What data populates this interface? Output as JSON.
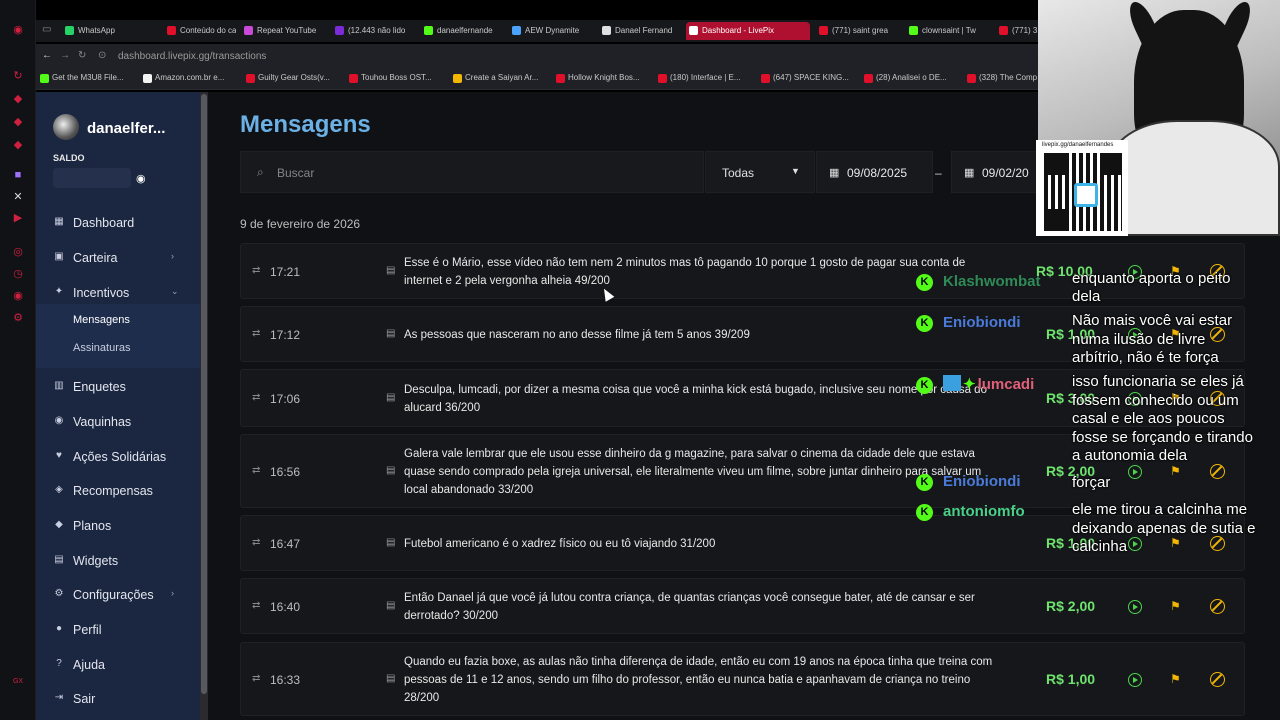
{
  "browser": {
    "tabs": [
      {
        "label": "WhatsApp",
        "color": "#25d366"
      },
      {
        "label": "Conteúdo do ca",
        "color": "#e0102b"
      },
      {
        "label": "Repeat YouTube",
        "color": "#c94ad8"
      },
      {
        "label": "(12.443 não lido",
        "color": "#7b2cd6"
      },
      {
        "label": "danaelfernande",
        "color": "#53fc18"
      },
      {
        "label": "AEW Dynamite",
        "color": "#4aa3ff"
      },
      {
        "label": "Danael Fernand",
        "color": "#e0e0e0"
      },
      {
        "label": "Dashboard - LivePix",
        "color": "#ffffff"
      },
      {
        "label": "(771) saint grea",
        "color": "#e0102b"
      },
      {
        "label": "clownsaint | Tw",
        "color": "#53fc18"
      },
      {
        "label": "(771) 3",
        "color": "#e0102b"
      }
    ],
    "url": "dashboard.livepix.gg/transactions",
    "bookmarks": [
      {
        "label": "Get the M3U8 File...",
        "color": "#53fc18"
      },
      {
        "label": "Amazon.com.br e...",
        "color": "#f3f3f3"
      },
      {
        "label": "Guilty Gear Osts(v...",
        "color": "#e0102b"
      },
      {
        "label": "Touhou Boss OST...",
        "color": "#e0102b"
      },
      {
        "label": "Create a Saiyan Ar...",
        "color": "#f2b705"
      },
      {
        "label": "Hollow Knight Bos...",
        "color": "#e0102b"
      },
      {
        "label": "(180) Interface | E...",
        "color": "#e0102b"
      },
      {
        "label": "(647) SPACE KING...",
        "color": "#e0102b"
      },
      {
        "label": "(28) Analisei o DE...",
        "color": "#e0102b"
      },
      {
        "label": "(328) The Comp",
        "color": "#e0102b"
      }
    ]
  },
  "sidebar": {
    "username": "danaelfer...",
    "saldo_label": "SALDO",
    "items": [
      {
        "label": "Dashboard",
        "icon": "dashboard-icon",
        "glyph": "▦"
      },
      {
        "label": "Carteira",
        "icon": "wallet-icon",
        "glyph": "▣",
        "chevron": "›"
      },
      {
        "label": "Incentivos",
        "icon": "sparkle-icon",
        "glyph": "✦",
        "chevron": "⌄"
      },
      {
        "label": "Enquetes",
        "icon": "poll-icon",
        "glyph": "▥"
      },
      {
        "label": "Vaquinhas",
        "icon": "piggy-icon",
        "glyph": "◉"
      },
      {
        "label": "Ações Solidárias",
        "icon": "heart-icon",
        "glyph": "♥"
      },
      {
        "label": "Recompensas",
        "icon": "gift-icon",
        "glyph": "◈"
      },
      {
        "label": "Planos",
        "icon": "plans-icon",
        "glyph": "◆"
      },
      {
        "label": "Widgets",
        "icon": "widgets-icon",
        "glyph": "▤"
      },
      {
        "label": "Configurações",
        "icon": "gear-icon",
        "glyph": "⚙",
        "chevron": "›"
      },
      {
        "label": "Perfil",
        "icon": "user-icon",
        "glyph": "●"
      },
      {
        "label": "Ajuda",
        "icon": "help-icon",
        "glyph": "?"
      },
      {
        "label": "Sair",
        "icon": "logout-icon",
        "glyph": "⇥"
      }
    ],
    "subitems": [
      {
        "label": "Mensagens"
      },
      {
        "label": "Assinaturas"
      }
    ]
  },
  "main": {
    "title": "Mensagens",
    "search_placeholder": "Buscar",
    "filter_value": "Todas",
    "date_from": "09/08/2025",
    "date_to": "09/02/20",
    "date_separator": "–",
    "date_heading": "9 de fevereiro de 2026",
    "rows": [
      {
        "time": "17:21",
        "message": "Esse é o Mário, esse vídeo não tem nem 2 minutos mas tô pagando 10 porque 1 gosto de pagar sua conta de internet e 2 pela vergonha alheia 49/200",
        "amount": "R$ 10,00"
      },
      {
        "time": "17:12",
        "message": "As pessoas que nasceram no ano desse filme já tem 5 anos 39/209",
        "amount": "R$ 1,00"
      },
      {
        "time": "17:06",
        "message": "Desculpa, lumcadi, por dizer a mesma coisa que você a minha kick está bugado, inclusive seu nome por causa do alucard 36/200",
        "amount": "R$ 3,00"
      },
      {
        "time": "16:56",
        "message": "Galera vale lembrar que ele usou esse dinheiro da g magazine, para salvar o cinema da cidade dele que estava quase sendo comprado pela igreja universal, ele literalmente viveu um filme, sobre juntar dinheiro para salvar um local abandonado 33/200",
        "amount": "R$ 2,00"
      },
      {
        "time": "16:47",
        "message": "Futebol americano é o xadrez físico ou eu tô viajando 31/200",
        "amount": "R$ 1,00"
      },
      {
        "time": "16:40",
        "message": "Então Danael já que você já lutou contra criança, de quantas crianças você consegue bater, até de cansar e ser derrotado? 30/200",
        "amount": "R$ 2,00"
      },
      {
        "time": "16:33",
        "message": "Quando eu fazia boxe, as aulas não tinha diferença de idade, então eu com 19 anos na época tinha que treina com pessoas de 11 e 12 anos, sendo um filho do professor, então eu nunca batia e apanhavam de criança no treino 28/200",
        "amount": "R$ 1,00"
      }
    ]
  },
  "overlay": {
    "qr_url": "livepix.gg/danaelfernandes",
    "chat_users": [
      {
        "name": "Klashwombat",
        "color": "#2e8b57"
      },
      {
        "name": "Eniobiondi",
        "color": "#4a7bd8"
      },
      {
        "name": "lumcadi",
        "color": "#e0607a"
      },
      {
        "name": "Eniobiondi",
        "color": "#4a7bd8"
      },
      {
        "name": "antoniomfo",
        "color": "#4ad08a"
      }
    ],
    "chat_lines": [
      "enquanto aporta o peito",
      "dela",
      "Não mais você vai estar",
      "numa ilusão de livre",
      "arbítrio, não é te força",
      "isso funcionaria se eles já",
      "fossem conhecido ou um",
      "casal e ele aos poucos",
      "fosse se forçando e tirando",
      "a autonomia dela",
      "forçar",
      "ele me tirou a calcinha me",
      "deixando apenas de sutia e",
      "calcinha"
    ]
  },
  "colors": {
    "accent_title": "#6cb1e6",
    "amount_green": "#6ee36e",
    "icon_yellow": "#f2b705",
    "sidebar_bg": "#1b2640",
    "active_tab": "#b01030"
  }
}
